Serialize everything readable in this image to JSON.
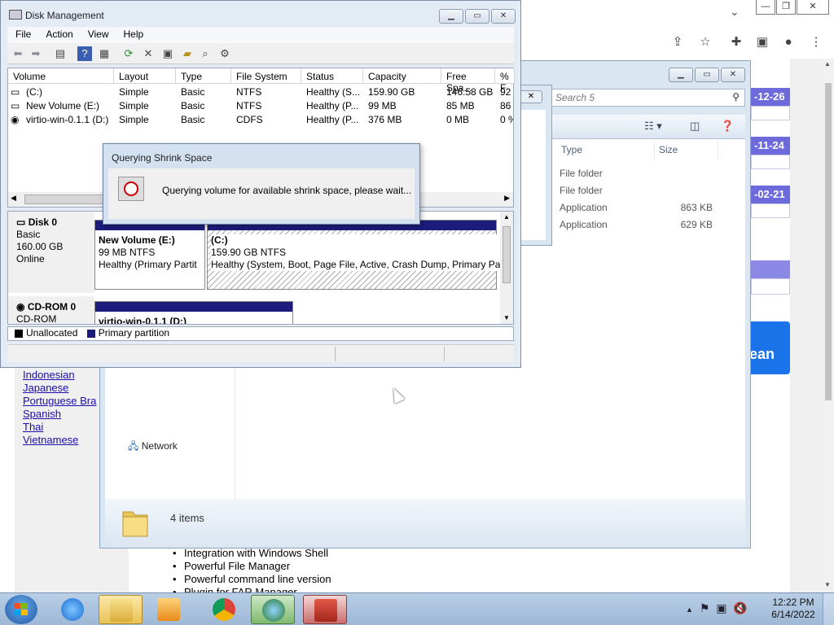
{
  "browser": {
    "controls": {
      "minimize": "—",
      "restore": "❐",
      "close": "✕"
    },
    "toolbar_icons": [
      "share-icon",
      "star-icon",
      "extensions-icon",
      "sidebar-icon",
      "profile-icon",
      "menu-icon"
    ],
    "dates": [
      "-12-26",
      "-11-24",
      "-02-21"
    ],
    "clean_button_partial": "ean",
    "languages": [
      "Indonesian",
      "Japanese",
      "Portuguese Bra",
      "Spanish",
      "Thai",
      "Vietnamese"
    ],
    "features": [
      "Integration with Windows Shell",
      "Powerful File Manager",
      "Powerful command line version",
      "Plugin for FAR Manager"
    ]
  },
  "explorer": {
    "search_placeholder": "Search 5",
    "columns": [
      "Type",
      "Size"
    ],
    "files": [
      {
        "type": "File folder",
        "size": ""
      },
      {
        "type": "File folder",
        "size": ""
      },
      {
        "type": "Application",
        "size": "863 KB"
      },
      {
        "type": "Application",
        "size": "629 KB"
      }
    ],
    "nav_network": "Network",
    "item_count": "4 items"
  },
  "disk_mgmt": {
    "title": "Disk Management",
    "menu": [
      "File",
      "Action",
      "View",
      "Help"
    ],
    "columns": [
      "Volume",
      "Layout",
      "Type",
      "File System",
      "Status",
      "Capacity",
      "Free Spa...",
      "% F"
    ],
    "volumes": [
      {
        "volume": "(C:)",
        "layout": "Simple",
        "type": "Basic",
        "fs": "NTFS",
        "status": "Healthy (S...",
        "capacity": "159.90 GB",
        "free": "146.58 GB",
        "pct": "92"
      },
      {
        "volume": "New Volume (E:)",
        "layout": "Simple",
        "type": "Basic",
        "fs": "NTFS",
        "status": "Healthy (P...",
        "capacity": "99 MB",
        "free": "85 MB",
        "pct": "86"
      },
      {
        "volume": "virtio-win-0.1.1 (D:)",
        "layout": "Simple",
        "type": "Basic",
        "fs": "CDFS",
        "status": "Healthy (P...",
        "capacity": "376 MB",
        "free": "0 MB",
        "pct": "0 %"
      }
    ],
    "disk0": {
      "name": "Disk 0",
      "type": "Basic",
      "size": "160.00 GB",
      "state": "Online"
    },
    "part_e": {
      "name": "New Volume  (E:)",
      "size": "99 MB NTFS",
      "status": "Healthy (Primary Partit"
    },
    "part_c": {
      "name": "(C:)",
      "size": "159.90 GB NTFS",
      "status": "Healthy (System, Boot, Page File, Active, Crash Dump, Primary Pa"
    },
    "cdrom": {
      "name": "CD-ROM 0",
      "type": "CD-ROM"
    },
    "part_d": {
      "name": "virtio-win-0.1.1  (D:)"
    },
    "legend": {
      "unallocated": "Unallocated",
      "primary": "Primary partition"
    },
    "colors": {
      "primary": "#1c1c7c",
      "unallocated": "#000000"
    }
  },
  "dialog": {
    "title": "Querying Shrink Space",
    "message": "Querying volume for available shrink space, please wait..."
  },
  "taskbar": {
    "time": "12:22 PM",
    "date": "6/14/2022"
  }
}
